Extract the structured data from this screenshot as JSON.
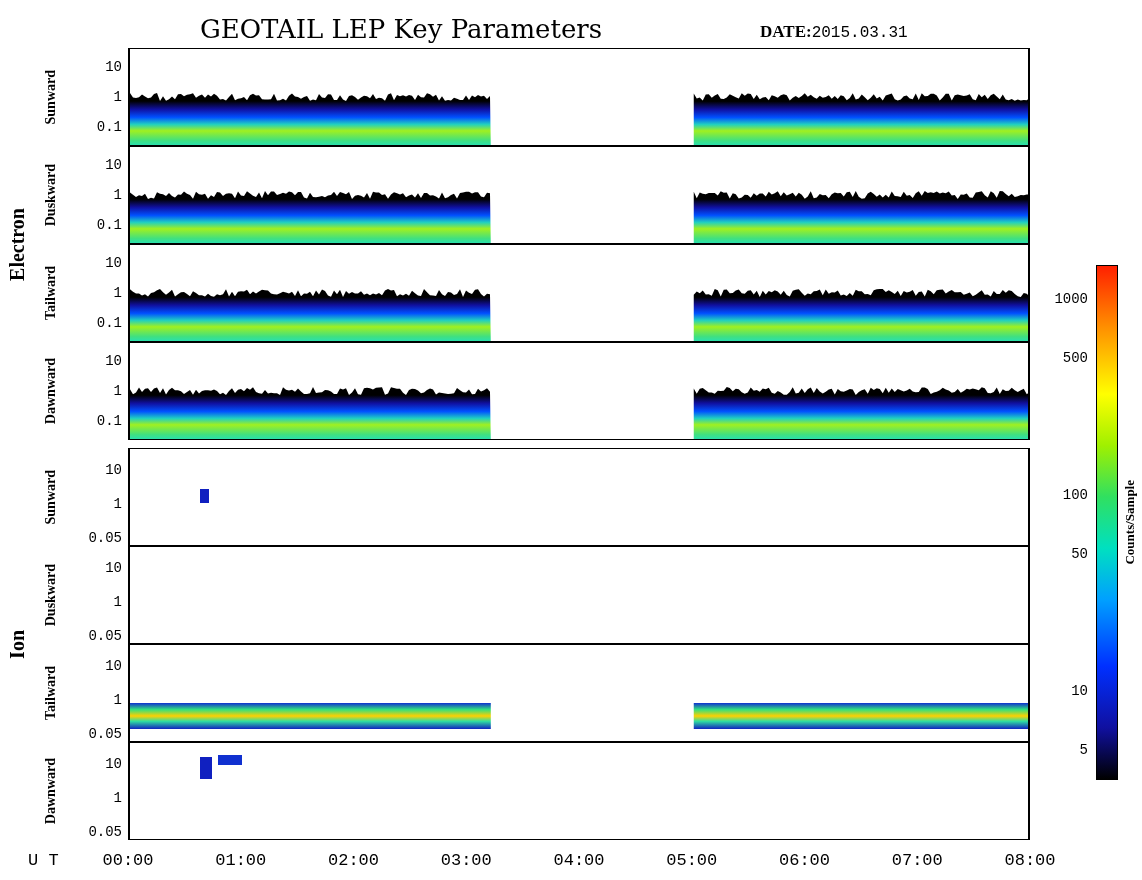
{
  "title": "GEOTAIL LEP Key Parameters",
  "date": {
    "label": "DATE:",
    "value": "2015.03.31"
  },
  "groups": [
    {
      "name": "Electron",
      "kind": "electron",
      "panels": [
        {
          "label": "Sunward",
          "yticks": [
            "10",
            "1",
            "0.1"
          ]
        },
        {
          "label": "Duskward",
          "yticks": [
            "10",
            "1",
            "0.1"
          ]
        },
        {
          "label": "Tailward",
          "yticks": [
            "10",
            "1",
            "0.1"
          ]
        },
        {
          "label": "Dawnward",
          "yticks": [
            "10",
            "1",
            "0.1"
          ]
        }
      ]
    },
    {
      "name": "Ion",
      "kind": "ion",
      "panels": [
        {
          "label": "Sunward",
          "yticks": [
            "10",
            "1",
            "0.05"
          ]
        },
        {
          "label": "Duskward",
          "yticks": [
            "10",
            "1",
            "0.05"
          ]
        },
        {
          "label": "Tailward",
          "yticks": [
            "10",
            "1",
            "0.05"
          ]
        },
        {
          "label": "Dawnward",
          "yticks": [
            "10",
            "1",
            "0.05"
          ]
        }
      ]
    }
  ],
  "time_axis": {
    "label": "U T",
    "ticks": [
      "00:00",
      "01:00",
      "02:00",
      "03:00",
      "04:00",
      "05:00",
      "06:00",
      "07:00",
      "08:00"
    ]
  },
  "colorbar": {
    "title": "Counts/Sample",
    "ticks": [
      "1000",
      "500",
      "100",
      "50",
      "10",
      "5"
    ]
  }
}
